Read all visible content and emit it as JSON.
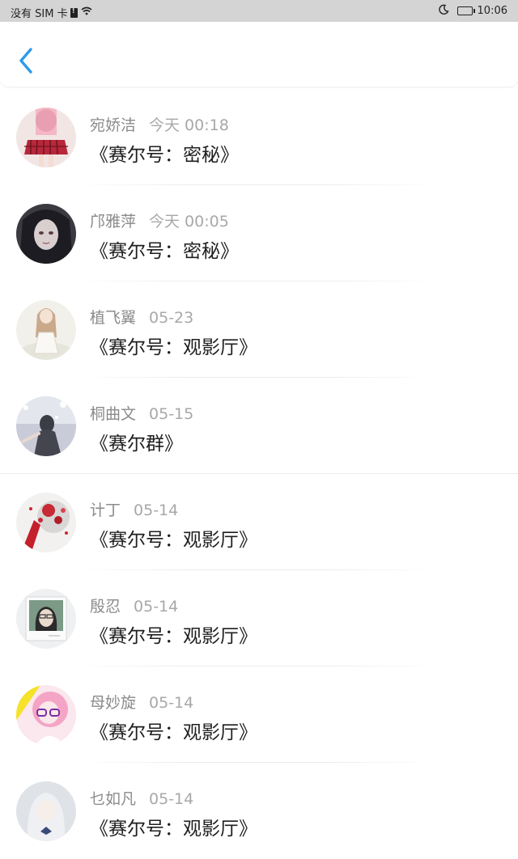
{
  "status_bar": {
    "carrier": "没有 SIM 卡",
    "time": "10:06"
  },
  "header": {
    "back_icon": "chevron-left-icon",
    "accent": "#2f9bea"
  },
  "messages": [
    {
      "name": "宛娇洁",
      "time": "今天 00:18",
      "subject": "《赛尔号：密秘》"
    },
    {
      "name": "邝雅萍",
      "time": "今天 00:05",
      "subject": "《赛尔号：密秘》"
    },
    {
      "name": "植飞翼",
      "time": "05-23",
      "subject": "《赛尔号：观影厅》"
    },
    {
      "name": "桐曲文",
      "time": "05-15",
      "subject": "《赛尔群》"
    },
    {
      "name": "计丁",
      "time": "05-14",
      "subject": "《赛尔号：观影厅》"
    },
    {
      "name": "殷忍",
      "time": "05-14",
      "subject": "《赛尔号：观影厅》"
    },
    {
      "name": "母妙旋",
      "time": "05-14",
      "subject": "《赛尔号：观影厅》"
    },
    {
      "name": "乜如凡",
      "time": "05-14",
      "subject": "《赛尔号：观影厅》"
    }
  ]
}
